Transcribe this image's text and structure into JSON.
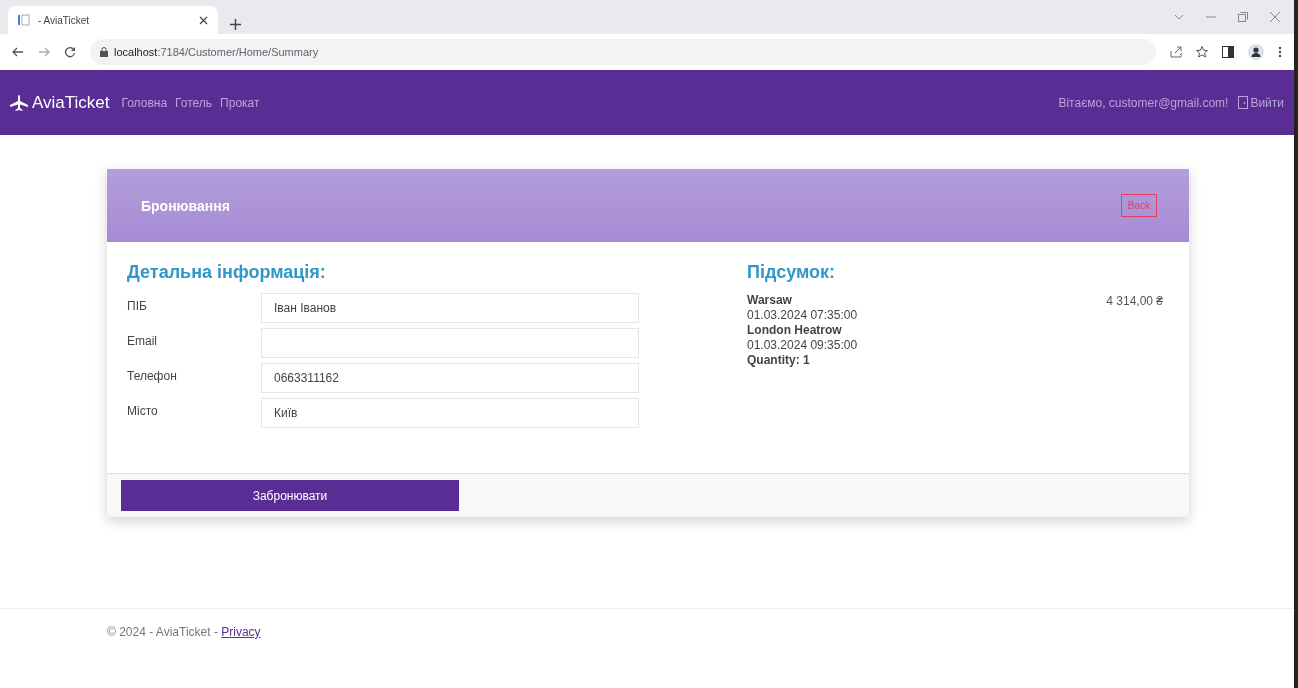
{
  "browser": {
    "tab_title": "- AviaTicket",
    "url_host": "localhost",
    "url_path": ":7184/Customer/Home/Summary"
  },
  "navbar": {
    "brand": "AviaTicket",
    "links": [
      {
        "label": "Головна"
      },
      {
        "label": "Готель"
      },
      {
        "label": "Прокат"
      }
    ],
    "greeting": "Вітаємо, customer@gmail.com!",
    "logout": "Вийти"
  },
  "card": {
    "title": "Бронювання",
    "back_button": "Back",
    "details": {
      "heading": "Детальна інформація:",
      "fields": [
        {
          "label": "ПІБ",
          "value": "Іван Іванов"
        },
        {
          "label": "Email"
        },
        {
          "label": "Телефон",
          "value": "0663311162"
        },
        {
          "label": "Місто",
          "value": "Київ"
        }
      ]
    },
    "summary": {
      "heading": "Підсумок:",
      "origin": "Warsaw",
      "departure": "01.03.2024 07:35:00",
      "destination": "London Heatrow",
      "arrival": "01.03.2024 09:35:00",
      "quantity": "Quantity: 1",
      "price": "4 314,00 ₴"
    },
    "submit_button": "Забронювати"
  },
  "footer": {
    "text": "© 2024 - AviaTicket - ",
    "link": "Privacy"
  }
}
